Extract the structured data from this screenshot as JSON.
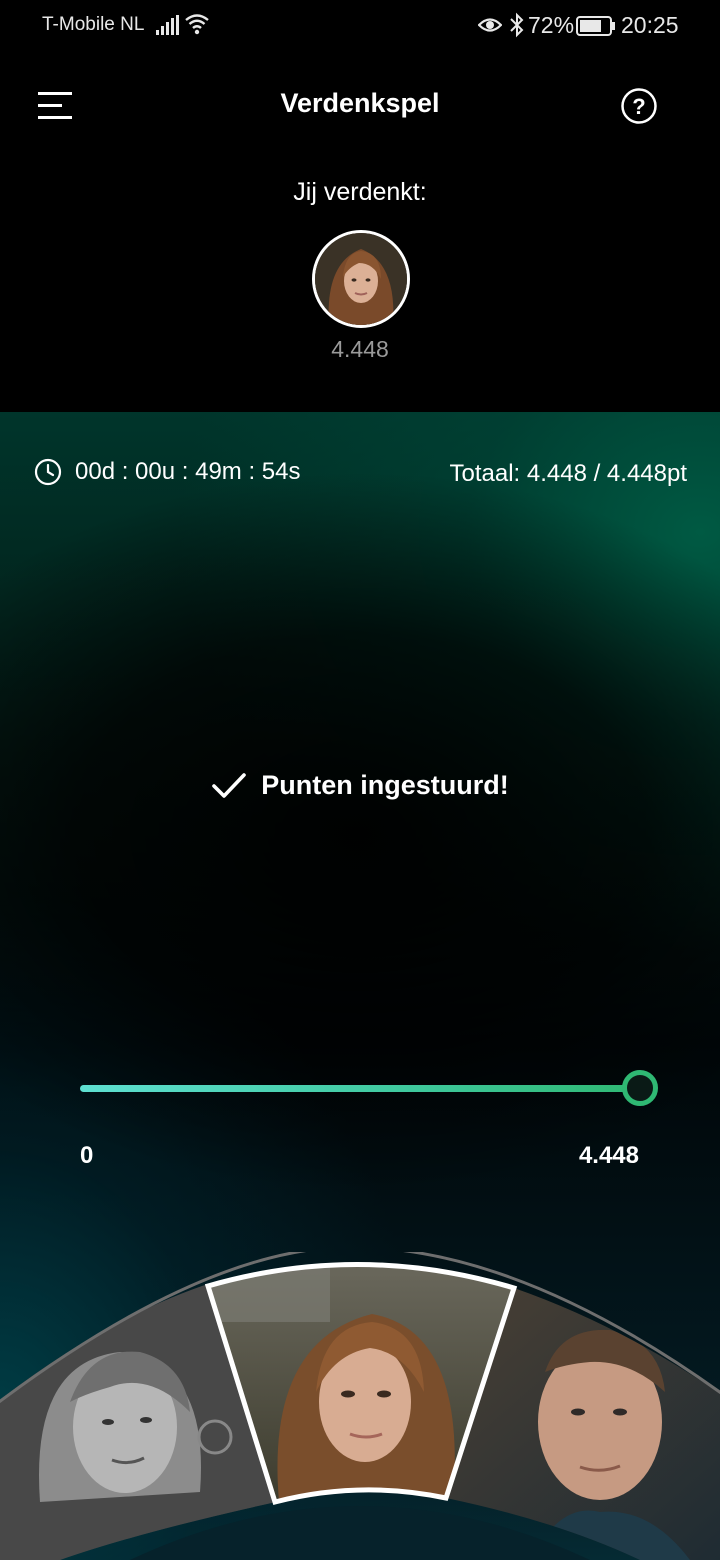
{
  "status_bar": {
    "carrier": "T-Mobile  NL",
    "battery": "72%",
    "time": "20:25",
    "icons": [
      "signal-icon",
      "wifi-icon",
      "eye-icon",
      "bluetooth-icon",
      "battery-icon"
    ]
  },
  "header": {
    "title": "Verdenkspel",
    "menu_icon": "menu-icon",
    "help_icon": "help-icon"
  },
  "suspect": {
    "label": "Jij verdenkt:",
    "points": "4.448"
  },
  "game": {
    "timer": "00d : 00u : 49m : 54s",
    "total": "Totaal: 4.448 / 4.448pt",
    "status_message": "Punten ingestuurd!",
    "slider": {
      "min_label": "0",
      "max_label": "4.448",
      "value": 4448,
      "max": 4448,
      "fraction": 1.0
    }
  },
  "carousel": {
    "items": [
      {
        "name": "candidate-left",
        "selected": false
      },
      {
        "name": "candidate-center",
        "selected": true
      },
      {
        "name": "candidate-right",
        "selected": false
      }
    ]
  },
  "colors": {
    "accent": "#2fb873",
    "track_start": "#5ee0d2",
    "background": "#000000",
    "muted_text": "#9a9a9a"
  }
}
